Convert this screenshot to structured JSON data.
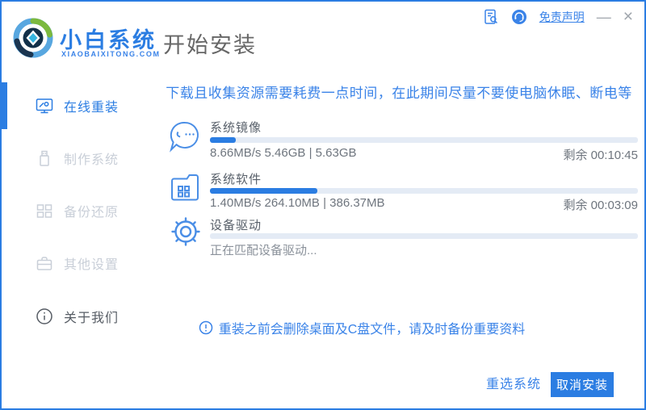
{
  "titlebar": {
    "brand_name": "小白系统",
    "brand_domain": "XIAOBAIXITONG.COM",
    "page_title": "开始安装",
    "disclaimer_link": "免责声明",
    "minimize_label": "—",
    "close_label": "×",
    "icons": [
      "doc-search-icon",
      "support-headset-icon"
    ]
  },
  "sidebar": {
    "items": [
      {
        "label": "在线重装",
        "icon": "monitor-reinstall-icon",
        "active": true
      },
      {
        "label": "制作系统",
        "icon": "usb-drive-icon",
        "active": false
      },
      {
        "label": "备份还原",
        "icon": "backup-grid-icon",
        "active": false
      },
      {
        "label": "其他设置",
        "icon": "toolbox-icon",
        "active": false
      },
      {
        "label": "关于我们",
        "icon": "info-circle-icon",
        "active": false
      }
    ]
  },
  "main": {
    "warning": "下载且收集资源需要耗费一点时间，在此期间尽量不要使电脑休眠、断电等",
    "tasks": [
      {
        "title": "系统镜像",
        "icon": "mascot-face-icon",
        "progress_percent": 6,
        "stats": "8.66MB/s 5.46GB | 5.63GB",
        "remaining": "剩余 00:10:45"
      },
      {
        "title": "系统软件",
        "icon": "folder-apps-icon",
        "progress_percent": 25,
        "stats": "1.40MB/s 264.10MB | 386.37MB",
        "remaining": "剩余 00:03:09"
      },
      {
        "title": "设备驱动",
        "icon": "gear-icon",
        "progress_percent": 0,
        "status": "正在匹配设备驱动..."
      }
    ],
    "notice": "重装之前会删除桌面及C盘文件，请及时备份重要资料",
    "notice_icon": "alert-circle-icon"
  },
  "footer": {
    "reselect_label": "重选系统",
    "cancel_label": "取消安装"
  },
  "colors": {
    "primary": "#2b7de2",
    "primary-soft": "#3a83e8",
    "track": "#e4ebf5",
    "inactive": "#c9cfd8"
  }
}
